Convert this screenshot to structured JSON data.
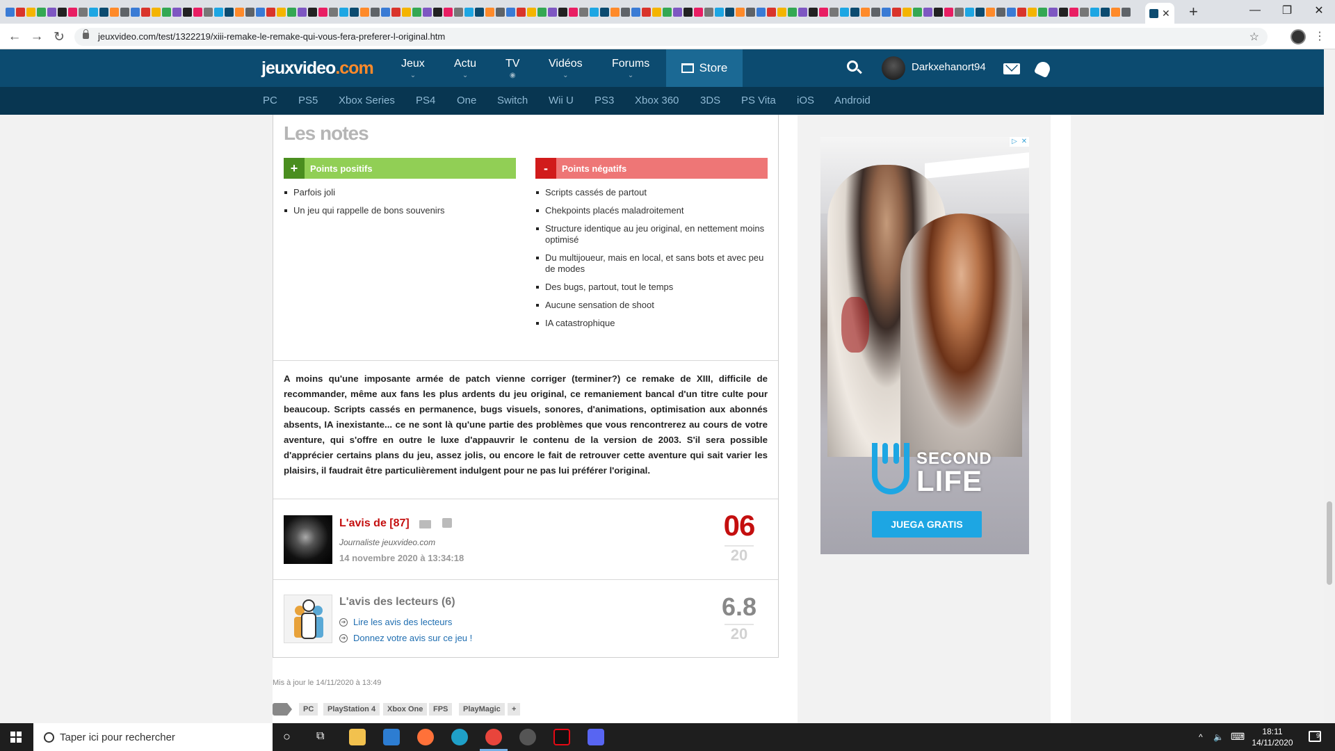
{
  "browser": {
    "url": "jeuxvideo.com/test/1322219/xiii-remake-le-remake-qui-vous-fera-preferer-l-original.htm",
    "favicon_colors": [
      "#3a7bd5",
      "#d9342b",
      "#f4b400",
      "#34a853",
      "#7e57c2",
      "#222",
      "#e91e63",
      "#777",
      "#1da6e3",
      "#0c4b70",
      "#ff8a2a",
      "#5f6368"
    ],
    "close_tab": "✕",
    "new_tab": "+",
    "minimize": "—",
    "maximize": "❐",
    "close_window": "✕",
    "back": "←",
    "forward": "→",
    "reload": "↻",
    "star": "☆",
    "menu": "⋮"
  },
  "site": {
    "logo_main": "jeuxvideo",
    "logo_tld": ".com",
    "nav": [
      "Jeux",
      "Actu",
      "TV",
      "Vidéos",
      "Forums"
    ],
    "nav_chev": [
      "⌄",
      "⌄",
      "◉",
      "⌄",
      "⌄"
    ],
    "store": "Store",
    "username": "Darkxehanort94",
    "platforms": [
      "PC",
      "PS5",
      "Xbox Series",
      "PS4",
      "One",
      "Switch",
      "Wii U",
      "PS3",
      "Xbox 360",
      "3DS",
      "PS Vita",
      "iOS",
      "Android"
    ]
  },
  "article": {
    "notes_title": "Les notes",
    "positive_label": "Points positifs",
    "positive_sign": "+",
    "negative_label": "Points négatifs",
    "negative_sign": "-",
    "positives": [
      "Parfois joli",
      "Un jeu qui rappelle de bons souvenirs"
    ],
    "negatives": [
      "Scripts cassés de partout",
      "Chekpoints placés maladroitement",
      "Structure identique au jeu original, en nettement moins optimisé",
      "Du multijoueur, mais en local, et sans bots et avec peu de modes",
      "Des bugs, partout, tout le temps",
      "Aucune sensation de shoot",
      "IA catastrophique"
    ],
    "conclusion": "A moins qu'une imposante armée de patch vienne corriger (terminer?) ce remake de XIII, difficile de recommander, même aux fans les plus ardents du jeu original, ce remaniement bancal d'un titre culte pour beaucoup. Scripts cassés en permanence, bugs visuels, sonores, d'animations, optimisation aux abonnés absents, IA inexistante... ce ne sont là qu'une partie des problèmes que vous rencontrerez au cours de votre aventure, qui s'offre en outre le luxe d'appauvrir le contenu de la version de 2003. S'il sera possible d'apprécier certains plans du jeu, assez jolis, ou encore le fait de retrouver cette aventure qui sait varier les plaisirs, il faudrait être particulièrement indulgent pour ne pas lui préférer l'original.",
    "review_title": "L'avis de [87]",
    "reviewer_role": "Journaliste jeuxvideo.com",
    "review_date": "14 novembre 2020 à 13:34:18",
    "score": "06",
    "score_max": "20",
    "readers_title": "L'avis des lecteurs (6)",
    "readers_link_read": "Lire les avis des lecteurs",
    "readers_link_give": "Donnez votre avis sur ce jeu !",
    "readers_score": "6.8",
    "readers_score_max": "20",
    "link_arrow": "➔",
    "updated": "Mis à jour le 14/11/2020 à 13:49",
    "tags": [
      "PC",
      "PlayStation 4",
      "Xbox One",
      "FPS",
      "PlayMagic",
      "+"
    ]
  },
  "ad": {
    "badge_i": "▷",
    "badge_x": "✕",
    "brand_line1": "SECOND",
    "brand_line2": "LIFE",
    "cta": "JUEGA GRATIS"
  },
  "taskbar": {
    "search_placeholder": "Taper ici pour rechercher",
    "cortana": "○",
    "taskview": "⧉",
    "tray_up": "^",
    "tray_volume": "🔈",
    "tray_keyboard": "⌨",
    "time": "18:11",
    "date": "14/11/2020",
    "notifications": "9"
  }
}
